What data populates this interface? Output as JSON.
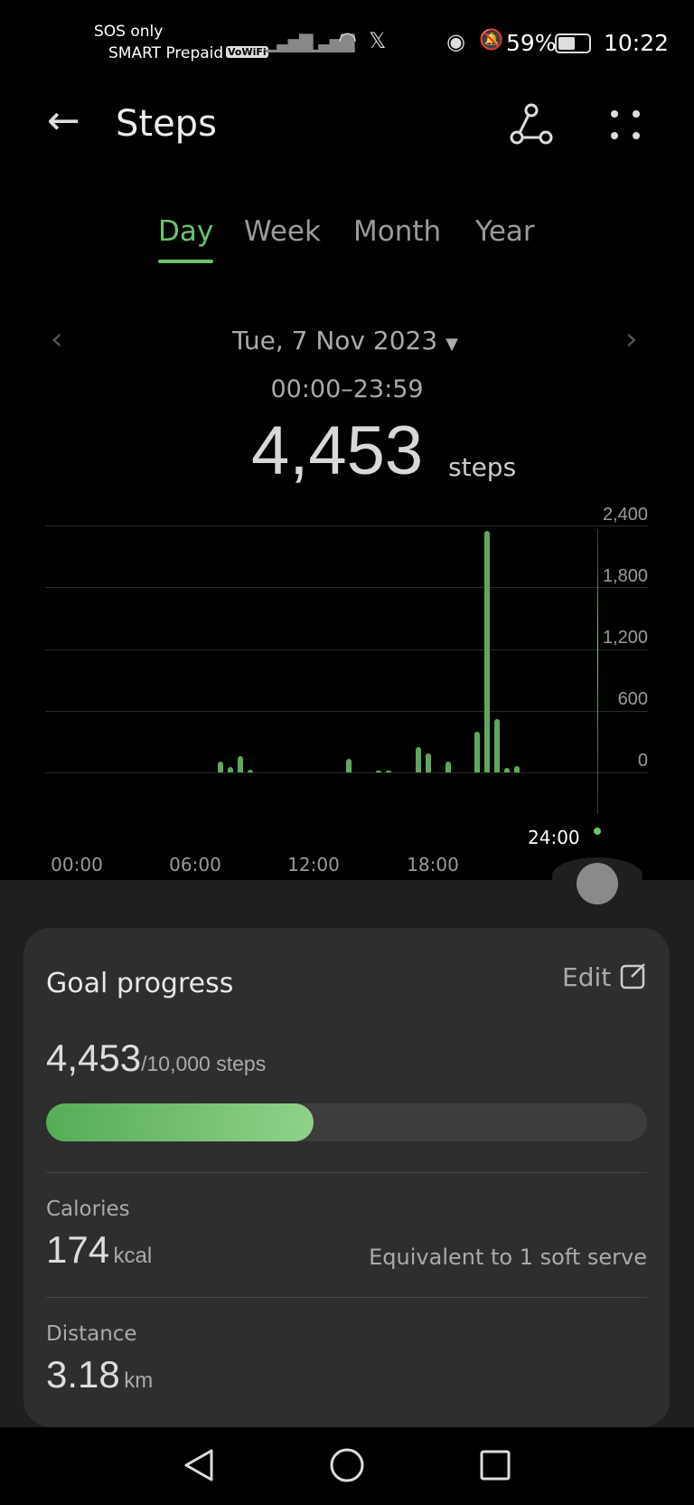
{
  "status_bar": {
    "line1": "SOS only",
    "line2": "SMART Prepaid",
    "vowifi": "VoWiFi",
    "battery": "59%",
    "time": "10:22"
  },
  "header": {
    "title": "Steps"
  },
  "tabs": [
    {
      "label": "Day",
      "active": true
    },
    {
      "label": "Week"
    },
    {
      "label": "Month"
    },
    {
      "label": "Year"
    }
  ],
  "date": {
    "label": "Tue, 7 Nov 2023",
    "range": "00:00–23:59"
  },
  "total": {
    "value": "4,453",
    "unit": "steps"
  },
  "chart_data": {
    "type": "bar",
    "y_ticks": [
      "2,400",
      "1,800",
      "1,200",
      "600",
      "0"
    ],
    "ylim": [
      0,
      2400
    ],
    "x_ticks": [
      "00:00",
      "06:00",
      "12:00",
      "18:00"
    ],
    "cursor_label": "24:00",
    "bar_color": "#5fa85a",
    "grid": true,
    "x": [
      "07:00",
      "07:30",
      "08:00",
      "08:30",
      "13:30",
      "15:00",
      "15:30",
      "17:00",
      "17:30",
      "18:30",
      "20:00",
      "20:30",
      "21:00",
      "21:30",
      "22:00"
    ],
    "values": [
      105,
      53,
      161,
      26,
      135,
      18,
      18,
      249,
      187,
      108,
      398,
      2350,
      515,
      47,
      64
    ]
  },
  "goal": {
    "title": "Goal progress",
    "edit": "Edit",
    "current": "4,453",
    "target": "/10,000 steps",
    "progress": 0.4453
  },
  "calories": {
    "label": "Calories",
    "value": "174",
    "unit": "kcal",
    "equivalent": "Equivalent to 1 soft serve"
  },
  "distance": {
    "label": "Distance",
    "value": "3.18",
    "unit": "km"
  }
}
